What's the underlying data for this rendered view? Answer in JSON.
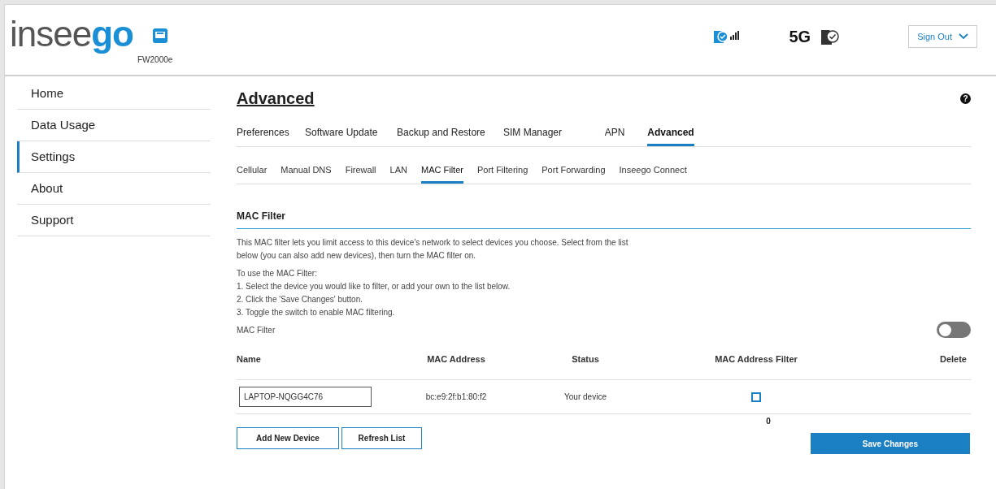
{
  "header": {
    "logo": [
      "insee",
      "go"
    ],
    "model": "FW2000e",
    "network": "5G",
    "sign_out": "Sign Out"
  },
  "sidebar": {
    "items": [
      {
        "label": "Home",
        "selected": false
      },
      {
        "label": "Data Usage",
        "selected": false
      },
      {
        "label": "Settings",
        "selected": true
      },
      {
        "label": "About",
        "selected": false
      },
      {
        "label": "Support",
        "selected": false
      }
    ]
  },
  "page_title": "Advanced",
  "help": "?",
  "tabs": [
    {
      "label": "Preferences",
      "selected": false
    },
    {
      "label": "Software Update",
      "selected": false
    },
    {
      "label": "Backup and Restore",
      "selected": false
    },
    {
      "label": "SIM Manager",
      "selected": false
    },
    {
      "label": "APN",
      "selected": false
    },
    {
      "label": "Advanced",
      "selected": true
    }
  ],
  "subtabs": [
    {
      "label": "Cellular",
      "selected": false
    },
    {
      "label": "Manual DNS",
      "selected": false
    },
    {
      "label": "Firewall",
      "selected": false
    },
    {
      "label": "LAN",
      "selected": false
    },
    {
      "label": "MAC Filter",
      "selected": true
    },
    {
      "label": "Port Filtering",
      "selected": false
    },
    {
      "label": "Port Forwarding",
      "selected": false
    },
    {
      "label": "Inseego Connect",
      "selected": false
    }
  ],
  "section_title": "MAC Filter",
  "description": "This MAC filter lets you limit access to this device's network to select devices you choose. Select from the list below (you can also add new devices), then turn the MAC filter on.",
  "steps": [
    "To use the MAC Filter:",
    "1. Select the device you would like to filter, or add your own to the list below.",
    "2. Click the 'Save Changes' button.",
    "3. Toggle the switch to enable MAC filtering."
  ],
  "mac_filter_switch": {
    "label": "MAC Filter",
    "on": false
  },
  "table": {
    "columns": [
      "Name",
      "MAC Address",
      "Status",
      "MAC Address Filter",
      "Delete"
    ],
    "rows": [
      {
        "name": "LAPTOP-NQGG4C76",
        "mac": "bc:e9:2f:b1:80:f2",
        "status": "Your device",
        "filter_checked": false
      }
    ]
  },
  "filter_count": "0",
  "buttons": {
    "add": "Add New Device",
    "refresh": "Refresh List",
    "save": "Save Changes"
  }
}
